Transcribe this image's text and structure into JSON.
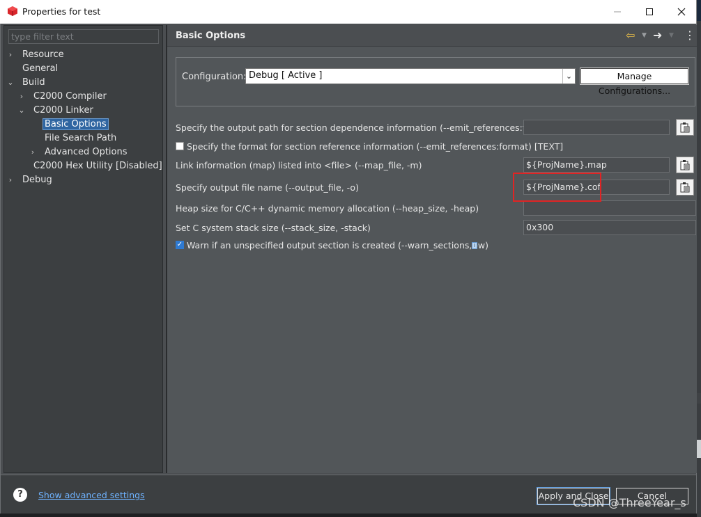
{
  "window": {
    "title": "Properties for test"
  },
  "filter": {
    "placeholder": "type filter text"
  },
  "tree": {
    "items": [
      {
        "label": "Resource"
      },
      {
        "label": "General"
      },
      {
        "label": "Build"
      },
      {
        "label": "C2000 Compiler"
      },
      {
        "label": "C2000 Linker"
      },
      {
        "label": "Basic Options"
      },
      {
        "label": "File Search Path"
      },
      {
        "label": "Advanced Options"
      },
      {
        "label": "C2000 Hex Utility  [Disabled]"
      },
      {
        "label": "Debug"
      }
    ]
  },
  "header": {
    "title": "Basic Options"
  },
  "config": {
    "label": "Configuration:",
    "selected": "Debug  [ Active ]",
    "manage_label": "Manage Configurations..."
  },
  "options": {
    "emit_refs_file_label": "Specify the output path for section dependence information (--emit_references:file)",
    "emit_refs_file_value": "",
    "emit_refs_format_label": "Specify the format for section reference information (--emit_references:format) [TEXT]",
    "emit_refs_format_checked": false,
    "map_label": "Link information (map) listed into <file> (--map_file, -m)",
    "map_value": "${ProjName}.map",
    "output_label": "Specify output file name (--output_file, -o)",
    "output_value": "${ProjName}.cof",
    "heap_label": "Heap size for C/C++ dynamic memory allocation (--heap_size, -heap)",
    "heap_value": "",
    "stack_label": "Set C system stack size (--stack_size, -stack)",
    "stack_value": "0x300",
    "warn_label": "Warn if an unspecified output section is created (--warn_sections, -w)",
    "warn_checked": true
  },
  "footer": {
    "advanced_link": "Show advanced settings",
    "apply_label": "Apply and Close",
    "cancel_label": "Cancel"
  },
  "watermark": "CSDN @ThreeYear_s",
  "colors": {
    "accent": "#2f65a1",
    "link": "#6fb3ff",
    "highlight": "#e02424"
  }
}
